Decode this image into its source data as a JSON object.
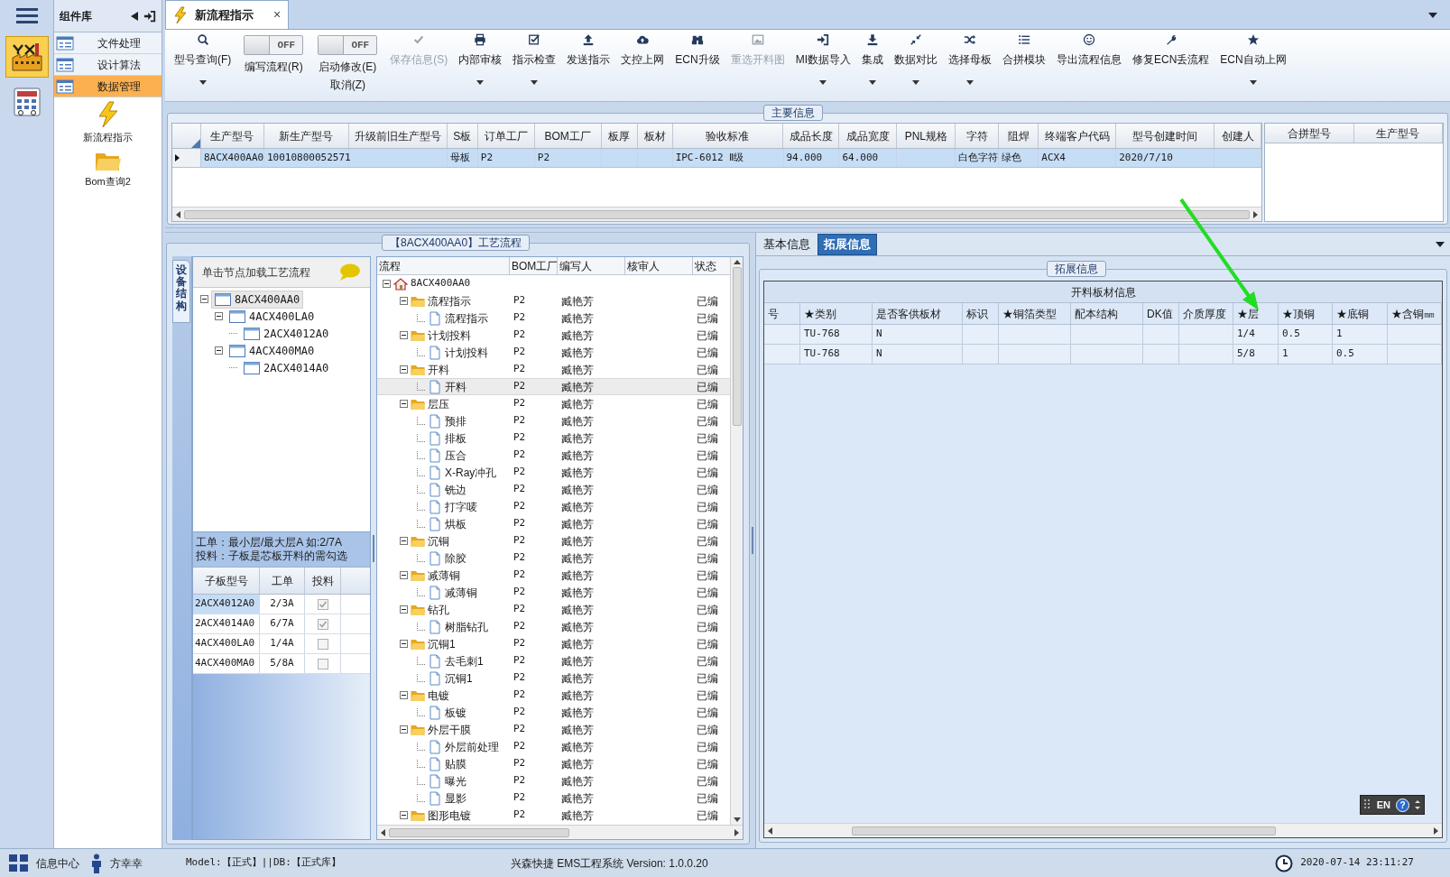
{
  "rail_items": [
    {
      "selected": true
    },
    {
      "selected": false
    }
  ],
  "component_library": {
    "title": "组件库",
    "items": [
      {
        "label": "文件处理",
        "selected": false
      },
      {
        "label": "设计算法",
        "selected": false
      },
      {
        "label": "数据管理",
        "selected": true
      }
    ],
    "tools": [
      {
        "label": "新流程指示"
      },
      {
        "label": "Bom查询2"
      }
    ]
  },
  "tabs": [
    {
      "label": "新流程指示",
      "selected": true,
      "close": "×"
    }
  ],
  "toolbar": [
    {
      "kind": "button",
      "label": "型号查询(F)",
      "dropdown": true,
      "disabled": false
    },
    {
      "kind": "toggle",
      "label": "编写流程(R)",
      "value": "OFF",
      "on": false
    },
    {
      "kind": "toggle",
      "label": "启动修改(E)",
      "sublabel": "取消(Z)",
      "value": "OFF",
      "on": false
    },
    {
      "kind": "button",
      "label": "保存信息(S)",
      "dropdown": false,
      "disabled": true
    },
    {
      "kind": "button",
      "label": "内部审核",
      "dropdown": true,
      "disabled": false
    },
    {
      "kind": "button",
      "label": "指示检查",
      "dropdown": true,
      "disabled": false
    },
    {
      "kind": "button",
      "label": "发送指示",
      "dropdown": false,
      "disabled": false
    },
    {
      "kind": "button",
      "label": "文控上网",
      "dropdown": false,
      "disabled": false
    },
    {
      "kind": "button",
      "label": "ECN升级",
      "dropdown": false,
      "disabled": false
    },
    {
      "kind": "button",
      "label": "重选开料图",
      "dropdown": false,
      "disabled": true
    },
    {
      "kind": "button",
      "label": "MI数据导入",
      "dropdown": true,
      "disabled": false
    },
    {
      "kind": "button",
      "label": "集成",
      "dropdown": true,
      "disabled": false
    },
    {
      "kind": "button",
      "label": "数据对比",
      "dropdown": true,
      "disabled": false
    },
    {
      "kind": "button",
      "label": "选择母板",
      "dropdown": true,
      "disabled": false
    },
    {
      "kind": "button",
      "label": "合拼模块",
      "dropdown": false,
      "disabled": false
    },
    {
      "kind": "button",
      "label": "导出流程信息",
      "dropdown": false,
      "disabled": false
    },
    {
      "kind": "button",
      "label": "修复ECN丢流程",
      "dropdown": false,
      "disabled": false
    },
    {
      "kind": "button",
      "label": "ECN自动上网",
      "dropdown": true,
      "disabled": false
    }
  ],
  "main_info": {
    "title": "主要信息",
    "columns": [
      "生产型号",
      "新生产型号",
      "升级前旧生产型号",
      "S板",
      "订单工厂",
      "BOM工厂",
      "板厚",
      "板材",
      "验收标准",
      "成品长度",
      "成品宽度",
      "PNL规格",
      "字符",
      "阻焊",
      "终端客户代码",
      "型号创建时间",
      "创建人"
    ],
    "rows": [
      {
        "selected": true,
        "cells": [
          "8ACX400AA0",
          "10010800052571",
          "",
          "母板",
          "P2",
          "P2",
          "",
          "",
          "IPC-6012 Ⅱ级",
          "94.000",
          "64.000",
          "",
          "白色字符",
          "绿色",
          "ACX4",
          "2020/7/10",
          ""
        ]
      }
    ],
    "side_columns": [
      "合拼型号",
      "生产型号"
    ]
  },
  "process": {
    "title": "【8ACX400AA0】工艺流程",
    "side_tab": "设备结构",
    "hint": "单击节点加载工艺流程",
    "structure": [
      {
        "label": "8ACX400AA0",
        "selected": true,
        "expanded": true,
        "children": [
          {
            "label": "4ACX400LA0",
            "selected": false,
            "expanded": true,
            "children": [
              {
                "label": "2ACX4012A0",
                "selected": false
              }
            ]
          },
          {
            "label": "4ACX400MA0",
            "selected": false,
            "expanded": true,
            "children": [
              {
                "label": "2ACX4014A0",
                "selected": false
              }
            ]
          }
        ]
      }
    ],
    "notes": [
      "工单：最小层/最大层A 如:2/7A",
      "投料：子板是芯板开料的需勾选"
    ],
    "boards": {
      "columns": [
        "子板型号",
        "工单",
        "投料"
      ],
      "rows": [
        {
          "board": "2ACX4012A0",
          "order": "2/3A",
          "feed": true,
          "selected": true
        },
        {
          "board": "2ACX4014A0",
          "order": "6/7A",
          "feed": true,
          "selected": false
        },
        {
          "board": "4ACX400LA0",
          "order": "1/4A",
          "feed": false,
          "selected": false
        },
        {
          "board": "4ACX400MA0",
          "order": "5/8A",
          "feed": false,
          "selected": false
        }
      ]
    },
    "flow": {
      "columns": [
        "流程",
        "BOM工厂",
        "编写人",
        "核审人",
        "状态"
      ],
      "tree": [
        {
          "kind": "root",
          "label": "8ACX400AA0",
          "expanded": true,
          "selected": false,
          "children": [
            {
              "kind": "group",
              "label": "流程指示",
              "bom": "P2",
              "writer": "臧艳芳",
              "status": "已编",
              "expanded": true,
              "selected": false,
              "children": [
                {
                  "kind": "step",
                  "label": "流程指示",
                  "bom": "P2",
                  "writer": "臧艳芳",
                  "status": "已编",
                  "selected": false
                }
              ]
            },
            {
              "kind": "group",
              "label": "计划投料",
              "bom": "P2",
              "writer": "臧艳芳",
              "status": "已编",
              "expanded": true,
              "selected": false,
              "children": [
                {
                  "kind": "step",
                  "label": "计划投料",
                  "bom": "P2",
                  "writer": "臧艳芳",
                  "status": "已编",
                  "selected": false
                }
              ]
            },
            {
              "kind": "group",
              "label": "开料",
              "bom": "P2",
              "writer": "臧艳芳",
              "status": "已编",
              "expanded": true,
              "selected": false,
              "children": [
                {
                  "kind": "step",
                  "label": "开料",
                  "bom": "P2",
                  "writer": "臧艳芳",
                  "status": "已编",
                  "selected": true
                }
              ]
            },
            {
              "kind": "group",
              "label": "层压",
              "bom": "P2",
              "writer": "臧艳芳",
              "status": "已编",
              "expanded": true,
              "selected": false,
              "children": [
                {
                  "kind": "step",
                  "label": "预排",
                  "bom": "P2",
                  "writer": "臧艳芳",
                  "status": "已编",
                  "selected": false
                },
                {
                  "kind": "step",
                  "label": "排板",
                  "bom": "P2",
                  "writer": "臧艳芳",
                  "status": "已编",
                  "selected": false
                },
                {
                  "kind": "step",
                  "label": "压合",
                  "bom": "P2",
                  "writer": "臧艳芳",
                  "status": "已编",
                  "selected": false
                },
                {
                  "kind": "step",
                  "label": "X-Ray冲孔",
                  "bom": "P2",
                  "writer": "臧艳芳",
                  "status": "已编",
                  "selected": false
                },
                {
                  "kind": "step",
                  "label": "铣边",
                  "bom": "P2",
                  "writer": "臧艳芳",
                  "status": "已编",
                  "selected": false
                },
                {
                  "kind": "step",
                  "label": "打字唛",
                  "bom": "P2",
                  "writer": "臧艳芳",
                  "status": "已编",
                  "selected": false
                },
                {
                  "kind": "step",
                  "label": "烘板",
                  "bom": "P2",
                  "writer": "臧艳芳",
                  "status": "已编",
                  "selected": false
                }
              ]
            },
            {
              "kind": "group",
              "label": "沉铜",
              "bom": "P2",
              "writer": "臧艳芳",
              "status": "已编",
              "expanded": true,
              "selected": false,
              "children": [
                {
                  "kind": "step",
                  "label": "除胶",
                  "bom": "P2",
                  "writer": "臧艳芳",
                  "status": "已编",
                  "selected": false
                }
              ]
            },
            {
              "kind": "group",
              "label": "减薄铜",
              "bom": "P2",
              "writer": "臧艳芳",
              "status": "已编",
              "expanded": true,
              "selected": false,
              "children": [
                {
                  "kind": "step",
                  "label": "减薄铜",
                  "bom": "P2",
                  "writer": "臧艳芳",
                  "status": "已编",
                  "selected": false
                }
              ]
            },
            {
              "kind": "group",
              "label": "钻孔",
              "bom": "P2",
              "writer": "臧艳芳",
              "status": "已编",
              "expanded": true,
              "selected": false,
              "children": [
                {
                  "kind": "step",
                  "label": "树脂钻孔",
                  "bom": "P2",
                  "writer": "臧艳芳",
                  "status": "已编",
                  "selected": false
                }
              ]
            },
            {
              "kind": "group",
              "label": "沉铜1",
              "bom": "P2",
              "writer": "臧艳芳",
              "status": "已编",
              "expanded": true,
              "selected": false,
              "children": [
                {
                  "kind": "step",
                  "label": "去毛刺1",
                  "bom": "P2",
                  "writer": "臧艳芳",
                  "status": "已编",
                  "selected": false
                },
                {
                  "kind": "step",
                  "label": "沉铜1",
                  "bom": "P2",
                  "writer": "臧艳芳",
                  "status": "已编",
                  "selected": false
                }
              ]
            },
            {
              "kind": "group",
              "label": "电镀",
              "bom": "P2",
              "writer": "臧艳芳",
              "status": "已编",
              "expanded": true,
              "selected": false,
              "children": [
                {
                  "kind": "step",
                  "label": "板镀",
                  "bom": "P2",
                  "writer": "臧艳芳",
                  "status": "已编",
                  "selected": false
                }
              ]
            },
            {
              "kind": "group",
              "label": "外层干膜",
              "bom": "P2",
              "writer": "臧艳芳",
              "status": "已编",
              "expanded": true,
              "selected": false,
              "children": [
                {
                  "kind": "step",
                  "label": "外层前处理",
                  "bom": "P2",
                  "writer": "臧艳芳",
                  "status": "已编",
                  "selected": false
                },
                {
                  "kind": "step",
                  "label": "贴膜",
                  "bom": "P2",
                  "writer": "臧艳芳",
                  "status": "已编",
                  "selected": false
                },
                {
                  "kind": "step",
                  "label": "曝光",
                  "bom": "P2",
                  "writer": "臧艳芳",
                  "status": "已编",
                  "selected": false
                },
                {
                  "kind": "step",
                  "label": "显影",
                  "bom": "P2",
                  "writer": "臧艳芳",
                  "status": "已编",
                  "selected": false
                }
              ]
            },
            {
              "kind": "group",
              "label": "图形电镀",
              "bom": "P2",
              "writer": "臧艳芳",
              "status": "已编",
              "expanded": true,
              "selected": false
            }
          ]
        }
      ]
    }
  },
  "detail": {
    "tabs": [
      {
        "label": "基本信息",
        "selected": false
      },
      {
        "label": "拓展信息",
        "selected": true
      }
    ],
    "group_title": "拓展信息",
    "table_title": "开料板材信息",
    "columns": [
      "号",
      "★类别",
      "是否客供板材",
      "标识",
      "★铜箔类型",
      "配本结构",
      "DK值",
      "介质厚度",
      "★层",
      "★顶铜",
      "★底铜",
      "★含铜㎜"
    ],
    "rows": [
      [
        "",
        "TU-768",
        "N",
        "",
        "",
        "",
        "",
        "",
        "1/4",
        "0.5",
        "1",
        ""
      ],
      [
        "",
        "TU-768",
        "N",
        "",
        "",
        "",
        "",
        "",
        "5/8",
        "1",
        "0.5",
        ""
      ]
    ],
    "language": "EN",
    "help": "?"
  },
  "status_bar": {
    "info": "信息中心",
    "user": "方幸幸",
    "model": "Model:【正式】||DB:【正式库】",
    "system": "兴森快捷 EMS工程系统 Version: 1.0.0.20",
    "time": "2020-07-14 23:11:27"
  }
}
